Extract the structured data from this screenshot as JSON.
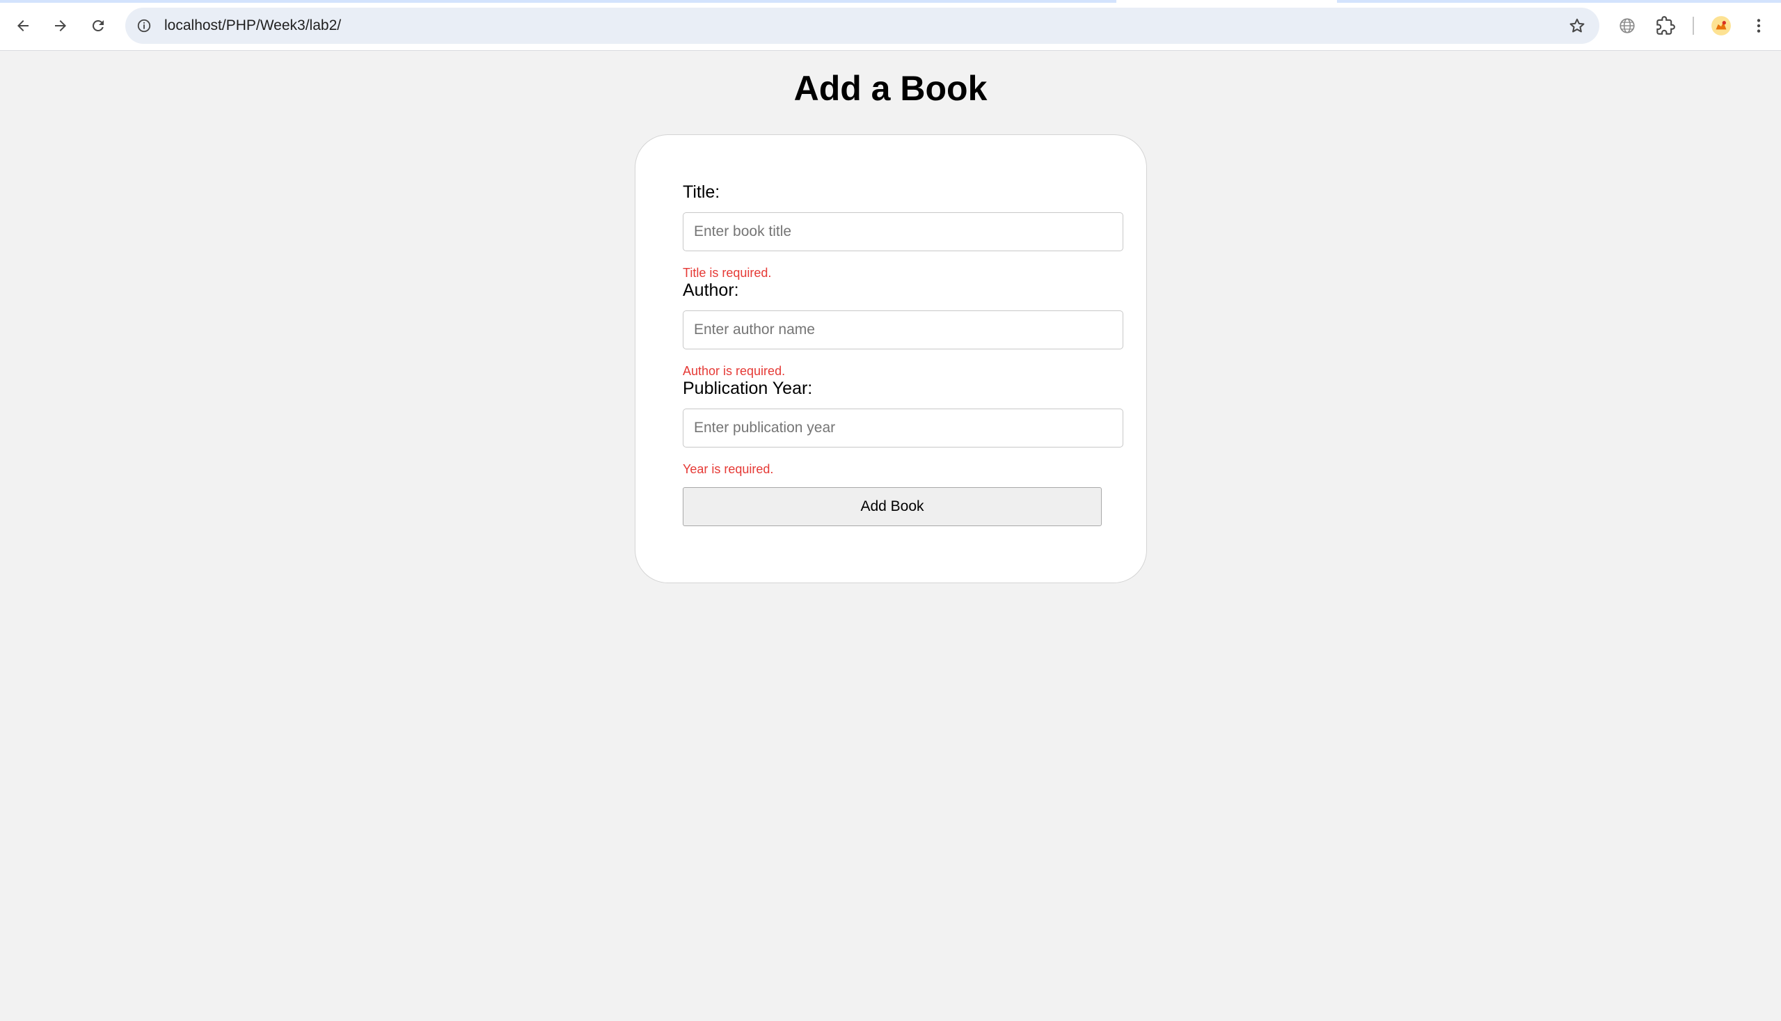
{
  "browser": {
    "url": "localhost/PHP/Week3/lab2/",
    "icons": {
      "back": "arrow-left-icon",
      "forward": "arrow-right-icon",
      "reload": "reload-icon",
      "site_info": "info-icon",
      "bookmark": "star-icon",
      "translate": "globe-icon",
      "extensions": "puzzle-icon",
      "profile": "profile-avatar-icon",
      "menu": "kebab-menu-icon"
    },
    "colors": {
      "omnibox_bg": "#e9eef6",
      "progress": "#d3e3fd"
    }
  },
  "page": {
    "title": "Add a Book",
    "form": {
      "title_label": "Title:",
      "title_placeholder": "Enter book title",
      "title_value": "",
      "title_error": "Title is required.",
      "author_label": "Author:",
      "author_placeholder": "Enter author name",
      "author_value": "",
      "author_error": "Author is required.",
      "year_label": "Publication Year:",
      "year_placeholder": "Enter publication year",
      "year_value": "",
      "year_error": "Year is required.",
      "submit_label": "Add Book"
    },
    "colors": {
      "background": "#f2f2f2",
      "card": "#ffffff",
      "error": "#e53935"
    }
  }
}
